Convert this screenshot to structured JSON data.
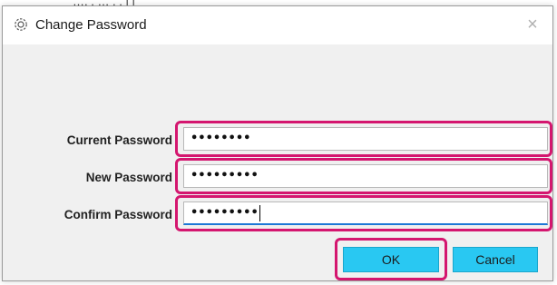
{
  "backdrop": {
    "text": "…, , … , ,  | |"
  },
  "dialog": {
    "title": "Change Password",
    "close_glyph": "×",
    "icon": "gear-icon"
  },
  "form": {
    "fields": [
      {
        "label": "Current Password",
        "value": "••••••••"
      },
      {
        "label": "New Password",
        "value": "•••••••••"
      },
      {
        "label": "Confirm Password",
        "value": "•••••••••"
      }
    ]
  },
  "buttons": {
    "ok": "OK",
    "cancel": "Cancel"
  },
  "colors": {
    "highlight": "#d4166f",
    "button": "#29c8f2",
    "focus": "#1e78d6"
  }
}
